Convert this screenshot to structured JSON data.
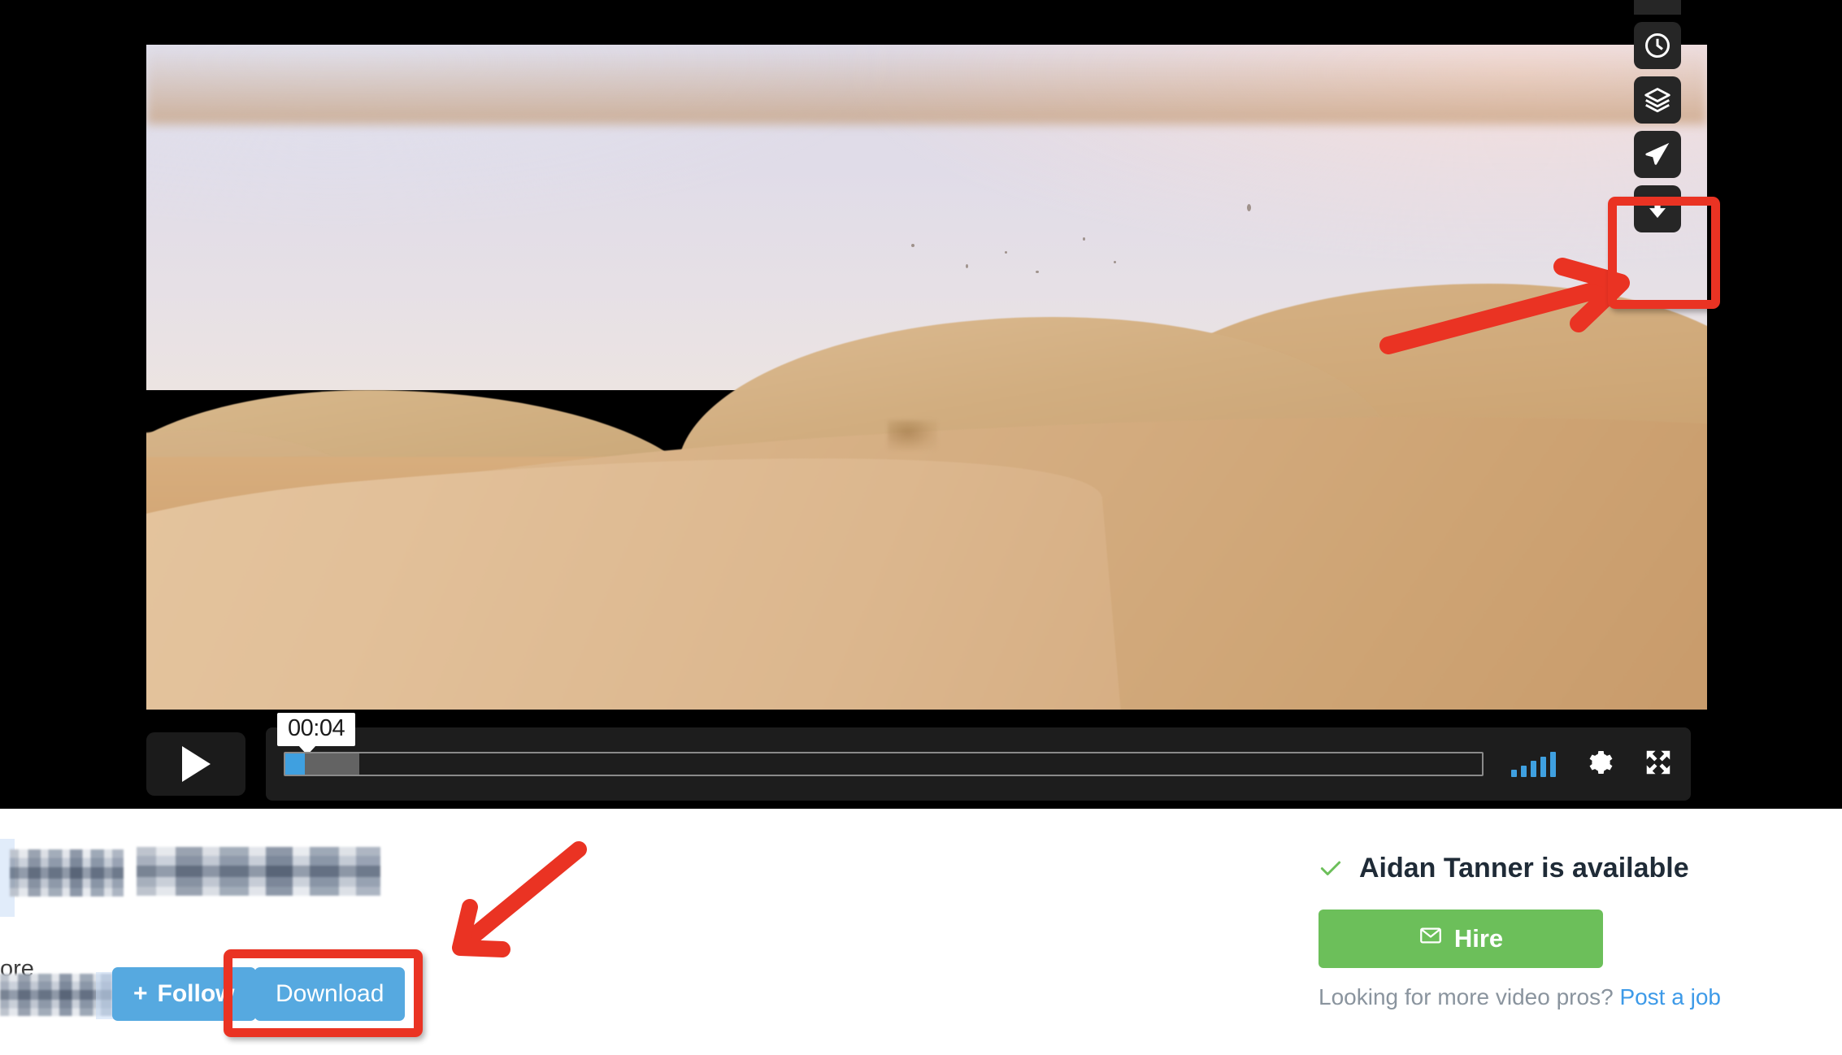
{
  "player": {
    "video_scene": "desert-sand-dunes-at-dusk",
    "play_button_label": "play-icon",
    "current_time_tooltip": "00:04",
    "progress_played_percent": 1.6,
    "progress_buffered_percent": 6.2,
    "volume_level_bars": 5,
    "settings_label": "settings-gear",
    "fullscreen_label": "fullscreen",
    "accent_blue": "#3fa0e0",
    "control_bg": "#1d1d1d"
  },
  "icon_stack": [
    {
      "name": "partial-button",
      "glyph": "partial"
    },
    {
      "name": "clock-icon",
      "glyph": "clock"
    },
    {
      "name": "layers-icon",
      "glyph": "layers"
    },
    {
      "name": "send-icon",
      "glyph": "send"
    },
    {
      "name": "download-icon",
      "glyph": "download"
    }
  ],
  "annotations": {
    "highlight_color": "#ea3323",
    "boxes": [
      {
        "name": "download-icon-highlight"
      },
      {
        "name": "download-button-highlight"
      }
    ],
    "arrows": [
      {
        "name": "arrow-to-download-icon",
        "direction": "up-right"
      },
      {
        "name": "arrow-to-download-button",
        "direction": "down-left"
      }
    ]
  },
  "bottom_left": {
    "title_redacted": true,
    "more_label": "ore",
    "follow_label": "Follow",
    "follow_plus": "+",
    "download_label": "Download",
    "button_blue": "#56a9e0"
  },
  "right_panel": {
    "availability_text": "Aidan Tanner is available",
    "check_color": "#6cbf5a",
    "hire_label": "Hire",
    "hire_icon": "envelope-icon",
    "hire_color": "#6cbf5a",
    "looking_prefix": "Looking for more video pros?",
    "post_job_link": "Post a job",
    "link_color": "#3d9ae8"
  }
}
